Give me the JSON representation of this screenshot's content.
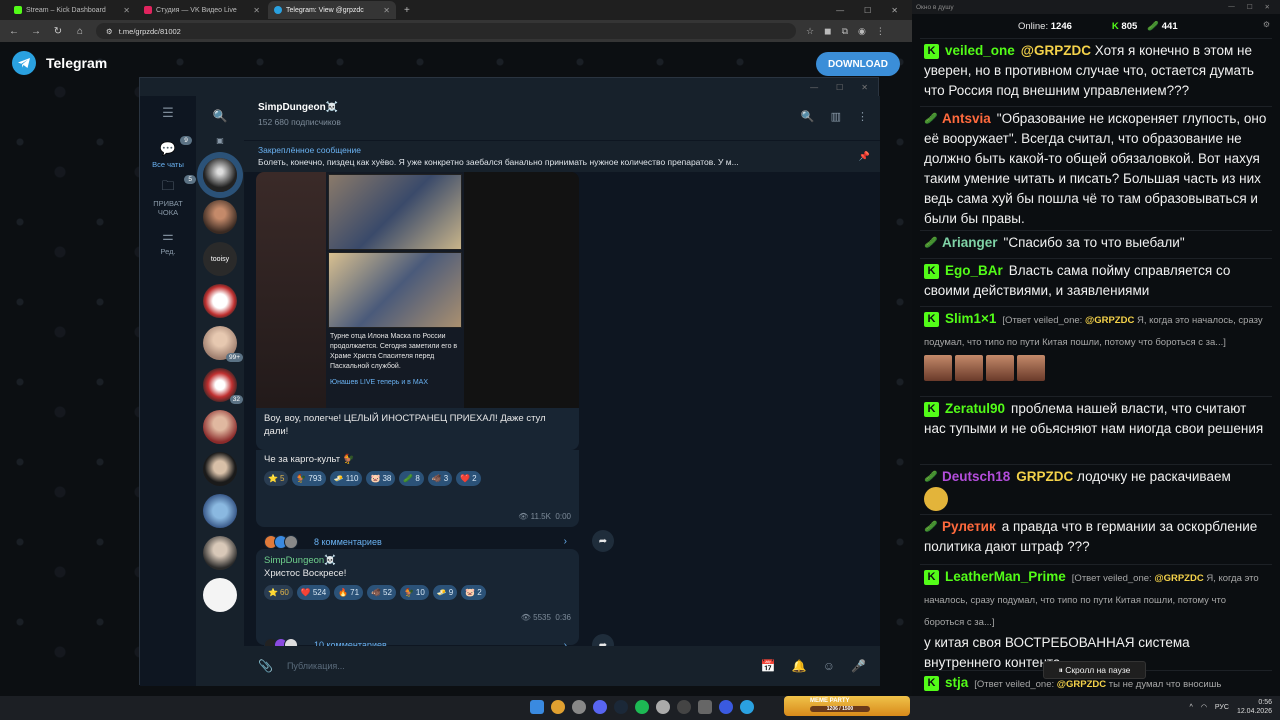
{
  "browser": {
    "tabs": [
      {
        "label": "Stream – Kick Dashboard",
        "color": "#53fc18"
      },
      {
        "label": "Студия — VK Видео Live",
        "color": "#e0245e"
      },
      {
        "label": "Telegram: View @grpzdc",
        "color": "#2aa1e0"
      }
    ],
    "url": "t.me/grpzdc/81002"
  },
  "telegram_web": {
    "brand": "Telegram",
    "download_label": "DOWNLOAD"
  },
  "tg": {
    "rail": [
      {
        "label": "Все чаты",
        "badge": "9",
        "icon": "chats-icon"
      },
      {
        "label": "ПРИВАТ ЧОКА",
        "badge": "5",
        "icon": "folder-icon"
      },
      {
        "label": "Ред.",
        "badge": "",
        "icon": "edit-filters-icon"
      }
    ],
    "chat_badges": {
      "five": "99+",
      "seven": "32"
    },
    "channel": {
      "name": "SimpDungeon☠️",
      "subscribers": "152 680 подписчиков"
    },
    "pinned": {
      "title": "Закреплённое сообщение",
      "text": "Болеть, конечно, пиздец как хуёво. Я уже конкретно заебался банально принимать нужное количество препаратов. У м..."
    },
    "post1": {
      "caption": "Турне отца Илона Маска по России продолжается. Сегодня заметили его в Храме Христа Спасителя перед Пасхальной службой.",
      "caption_src": "Юнашев LIVE теперь и в MAX",
      "text": "Воу, воу, полегче! ЦЕЛЫЙ ИНОСТРАНЕЦ ПРИЕХАЛ! Даже стул дали!",
      "text2": "Че за карго-культ 🐓",
      "reactions": [
        {
          "e": "⭐",
          "n": "5",
          "star": true
        },
        {
          "e": "🐓",
          "n": "793"
        },
        {
          "e": "🧈",
          "n": "110"
        },
        {
          "e": "🐷",
          "n": "38"
        },
        {
          "e": "🥒",
          "n": "8"
        },
        {
          "e": "🐗",
          "n": "3"
        },
        {
          "e": "❤️",
          "n": "2"
        }
      ],
      "views": "👁 11.5K",
      "time": "0:00",
      "comments": "8 комментариев"
    },
    "post2": {
      "name": "SimpDungeon☠️",
      "text": "Христос Воскресе!",
      "reactions": [
        {
          "e": "⭐",
          "n": "60",
          "star": true
        },
        {
          "e": "❤️",
          "n": "524"
        },
        {
          "e": "🔥",
          "n": "71"
        },
        {
          "e": "🐗",
          "n": "52"
        },
        {
          "e": "🐓",
          "n": "10"
        },
        {
          "e": "🧈",
          "n": "9"
        },
        {
          "e": "🐷",
          "n": "2"
        }
      ],
      "views": "👁 5535",
      "time": "0:36",
      "comments": "10 комментариев"
    },
    "composer_placeholder": "Публикация..."
  },
  "kick": {
    "window_title": "Окно в душу",
    "online_label": "Online:",
    "online": "1246",
    "stat1": "805",
    "stat2": "441",
    "pause_label": "⏸ Скролл на паузе",
    "messages": [
      {
        "user": "veiled_one",
        "color": "#53fc18",
        "badge": "kick",
        "mention": "@GRPZDC",
        "text": "Хотя я конечно в этом не уверен, но в противном случае что, остается думать что Россия под внешним управлением???"
      },
      {
        "user": "Antsvia",
        "color": "#ff6a3d",
        "badge": "sub",
        "text": "\"Образование не искореняет глупость, оно её вооружает\". Всегда считал, что образование не должно быть какой-то общей обязаловкой. Вот нахуя таким умение читать и писать? Большая часть из них ведь сама хуй бы пошла чё то там образовываться и были бы правы."
      },
      {
        "user": "Arianger",
        "color": "#7fd3a6",
        "badge": "sub",
        "text": "\"Спасибо за то что выебали\""
      },
      {
        "user": "Ego_BAr",
        "color": "#53fc18",
        "badge": "kick",
        "text": "Власть сама пойму справляется со своими действиями, и заявлениями"
      },
      {
        "user": "Slim1×1",
        "color": "#53fc18",
        "badge": "kick",
        "reply_prefix": "[Ответ veiled_one:",
        "reply_at": "@GRPZDC",
        "reply_text": "Я, когда это началось, сразу подумал, что типо по пути Китая пошли, потому что бороться с за...]"
      },
      {
        "user": "Zeratul90",
        "color": "#53fc18",
        "badge": "kick",
        "text": "проблема нашей власти, что считают нас тупыми и не обьясняют нам ниогда свои решения"
      },
      {
        "user": "Deutsch18",
        "color": "#b34ddb",
        "badge": "sub",
        "mention": "GRPZDC",
        "text": "лодочку не раскачиваем"
      },
      {
        "user": "Рулетик",
        "color": "#ff6a3d",
        "badge": "sub",
        "text": "а правда что в германии за оскорбление политика дают штраф ???"
      },
      {
        "user": "LeatherMan_Prime",
        "color": "#53fc18",
        "badge": "kick",
        "reply_prefix": "[Ответ veiled_one:",
        "reply_at": "@GRPZDC",
        "reply_text": "Я, когда это началось, сразу подумал, что типо по пути Китая пошли, потому что бороться с за...]",
        "text": "у китая своя ВОСТРЕБОВАННАЯ система внутреннего контента"
      },
      {
        "user": "stja",
        "color": "#53fc18",
        "badge": "kick",
        "reply_prefix": "[Ответ veiled_one:",
        "reply_at": "@GRPZDC",
        "reply_text": "ты не думал что вносишь"
      }
    ]
  },
  "taskbar": {
    "meme_title": "MEME PARTY",
    "meme_progress": "1206 / 1500",
    "lang": "РУС",
    "time": "0:56",
    "date": "12.04.2026"
  }
}
